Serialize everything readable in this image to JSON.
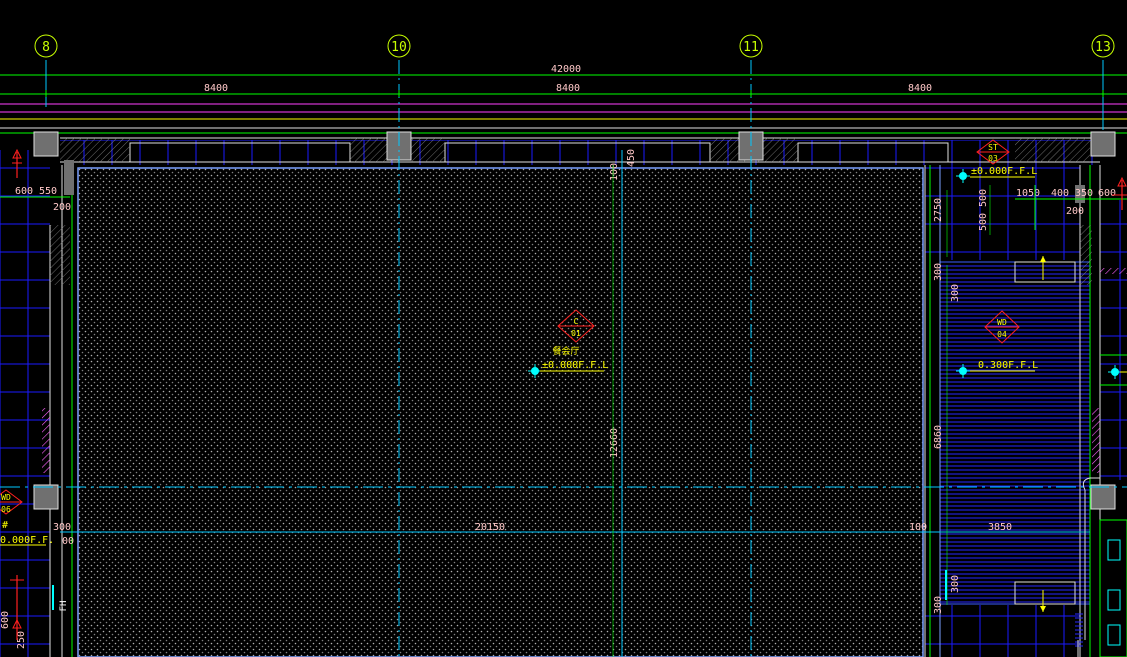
{
  "grid_axes": [
    "8",
    "10",
    "11",
    "13"
  ],
  "dimensions_top": {
    "overall": "42000",
    "segments": [
      "8400",
      "8400",
      "8400"
    ]
  },
  "room": {
    "name": "餐会厅",
    "tag_top": "C",
    "tag_bottom": "01",
    "level": "±0.000F.F.L"
  },
  "side_room": {
    "tag_top": "WD",
    "tag_bottom": "04",
    "level": "0.300F.F.L"
  },
  "stair_area": {
    "tag_top": "ST",
    "tag_bottom": "03",
    "level": "±0.000F.F.L"
  },
  "left_tag": {
    "tag_top": "WD",
    "tag_bottom": "06",
    "level": "0.000F.F."
  },
  "dimension_labels": {
    "hall_width": "20150",
    "hall_depth": "12660",
    "top_offset_100": "100",
    "top_offset_450": "450",
    "right_offset_100": "100",
    "side_width": "3850",
    "side_depth": "6860",
    "upper_2750": "2750",
    "upper_500a": "500",
    "upper_500b": "500",
    "right_300a": "300",
    "right_300b": "300",
    "right_300c": "300",
    "right_300d": "300",
    "left_600": "600",
    "left_550": "550",
    "left_200": "200",
    "left_300": "300",
    "left_00": "00",
    "left_600b": "600",
    "left_250": "250",
    "right_1050": "1050",
    "right_400": "400",
    "right_350": "350",
    "right_600": "600",
    "right_200": "200",
    "hash": "#",
    "fh": "FH"
  },
  "colors": {
    "background": "#000000",
    "grid_bubble": "#c8ff00",
    "dimension_line": "#00ff00",
    "dimension_text": "#ffc8c8",
    "wall": "#e0e0e0",
    "column": "#707070",
    "tile_grid": "#1a1aff",
    "center_line": "#00c8ff",
    "room_outline": "#7aa0ff",
    "tag_red": "#ff2020",
    "tag_text": "#ffff00",
    "level_marker": "#00ffff",
    "magenta": "#ff40ff",
    "yellow_line": "#ffff00",
    "hatch": "#ff60ff",
    "white_text": "#ffffff"
  }
}
